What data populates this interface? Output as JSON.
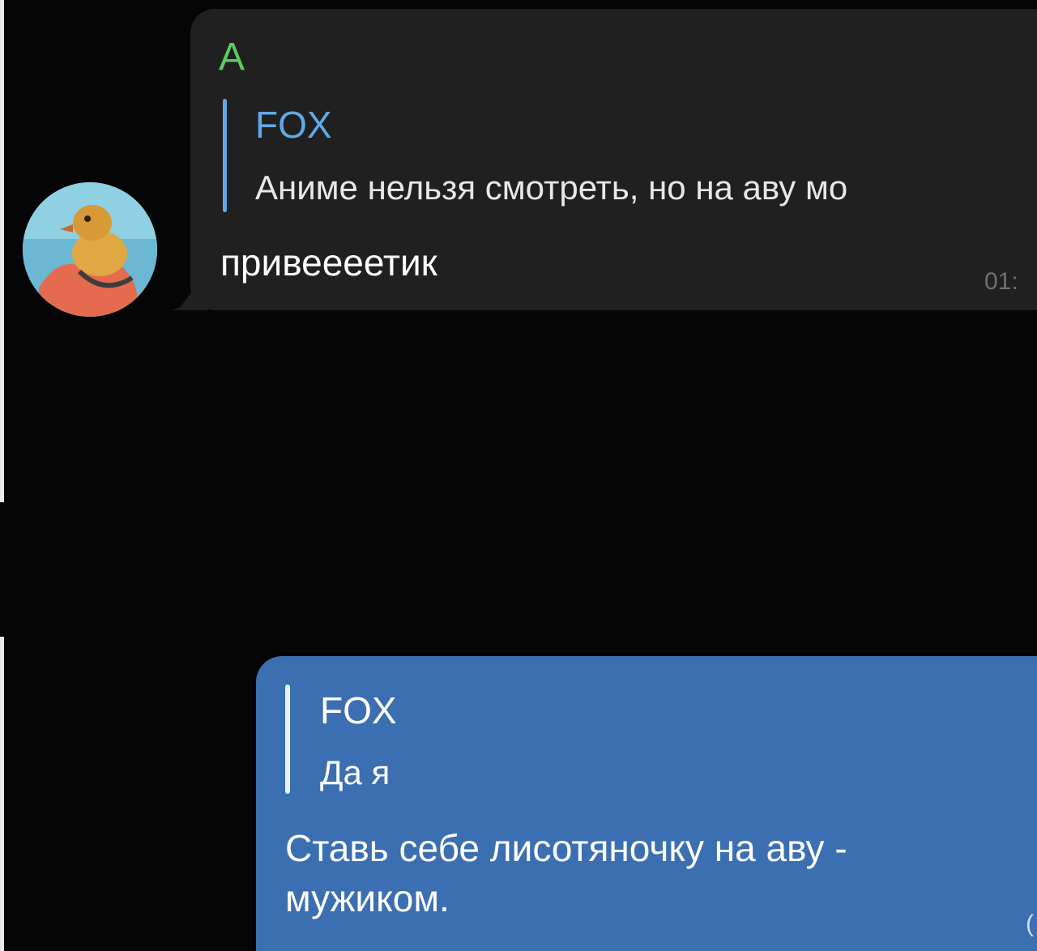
{
  "chat": {
    "messages": [
      {
        "direction": "incoming",
        "sender": "A",
        "reply": {
          "name": "FOX",
          "text": "Аниме нельзя смотреть, но на аву мо"
        },
        "text": "привеееетик",
        "time": "01:",
        "avatar_icon": "duck-avatar-icon"
      },
      {
        "direction": "outgoing",
        "reply": {
          "name": "FOX",
          "text": "Да я"
        },
        "text": "Ставь себе лисотяночку на аву -\nмужиком.",
        "time": "("
      }
    ]
  },
  "colors": {
    "background": "#050505",
    "incoming_bubble": "#202020",
    "outgoing_bubble": "#3c6fb1",
    "sender_name": "#5ccc62",
    "reply_accent": "#62a8e6"
  }
}
